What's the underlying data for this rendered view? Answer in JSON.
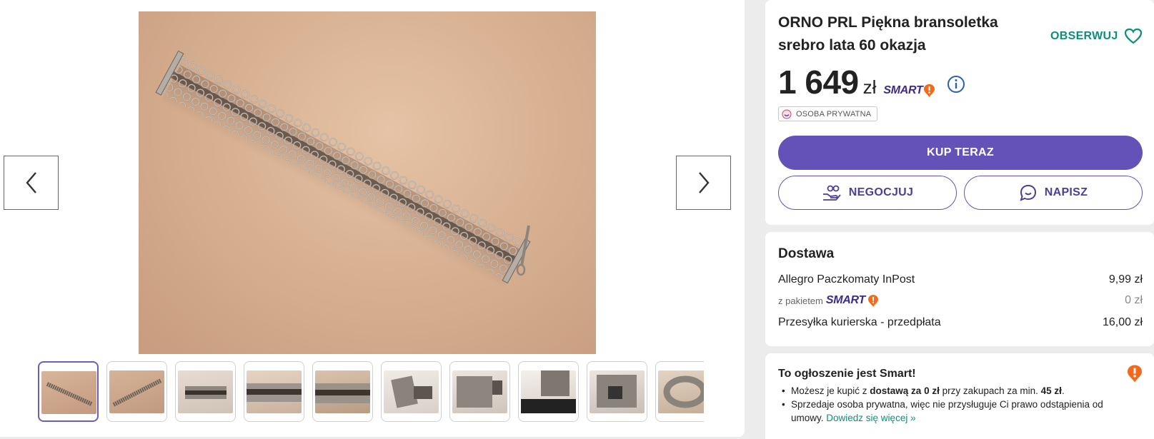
{
  "offer": {
    "title": "ORNO PRL Piękna bransoletka srebro lata 60 okazja",
    "observe_label": "OBSERWUJ",
    "price_value": "1 649",
    "price_currency": "zł",
    "smart_label": "SMART",
    "seller_badge": "OSOBA PRYWATNA",
    "buy_label": "KUP TERAZ",
    "negotiate_label": "NEGOCJUJ",
    "message_label": "NAPISZ"
  },
  "delivery": {
    "heading": "Dostawa",
    "rows": [
      {
        "name": "Allegro Paczkomaty InPost",
        "price": "9,99 zł"
      },
      {
        "name": "z pakietem",
        "price": "0 zł"
      },
      {
        "name": "Przesyłka kurierska - przedpłata",
        "price": "16,00 zł"
      }
    ],
    "smart_label": "SMART"
  },
  "smart_info": {
    "heading": "To ogłoszenie jest Smart!",
    "b1_pre": "Możesz je kupić z ",
    "b1_bold": "dostawą za 0 zł",
    "b1_mid": " przy zakupach za min. ",
    "b1_bold2": "45 zł",
    "b1_end": ".",
    "b2_text": "Sprzedaje osoba prywatna, więc nie przysługuje Ci prawo odstąpienia od umowy.",
    "b2_link": "Dowiedz się więcej »"
  },
  "colors": {
    "accent": "#6552b8",
    "observe": "#0e8e7a",
    "smart_orange": "#f26a1b",
    "smart_purple": "#3e2a8a"
  },
  "gallery": {
    "thumb_count": 10,
    "active_index": 0
  }
}
